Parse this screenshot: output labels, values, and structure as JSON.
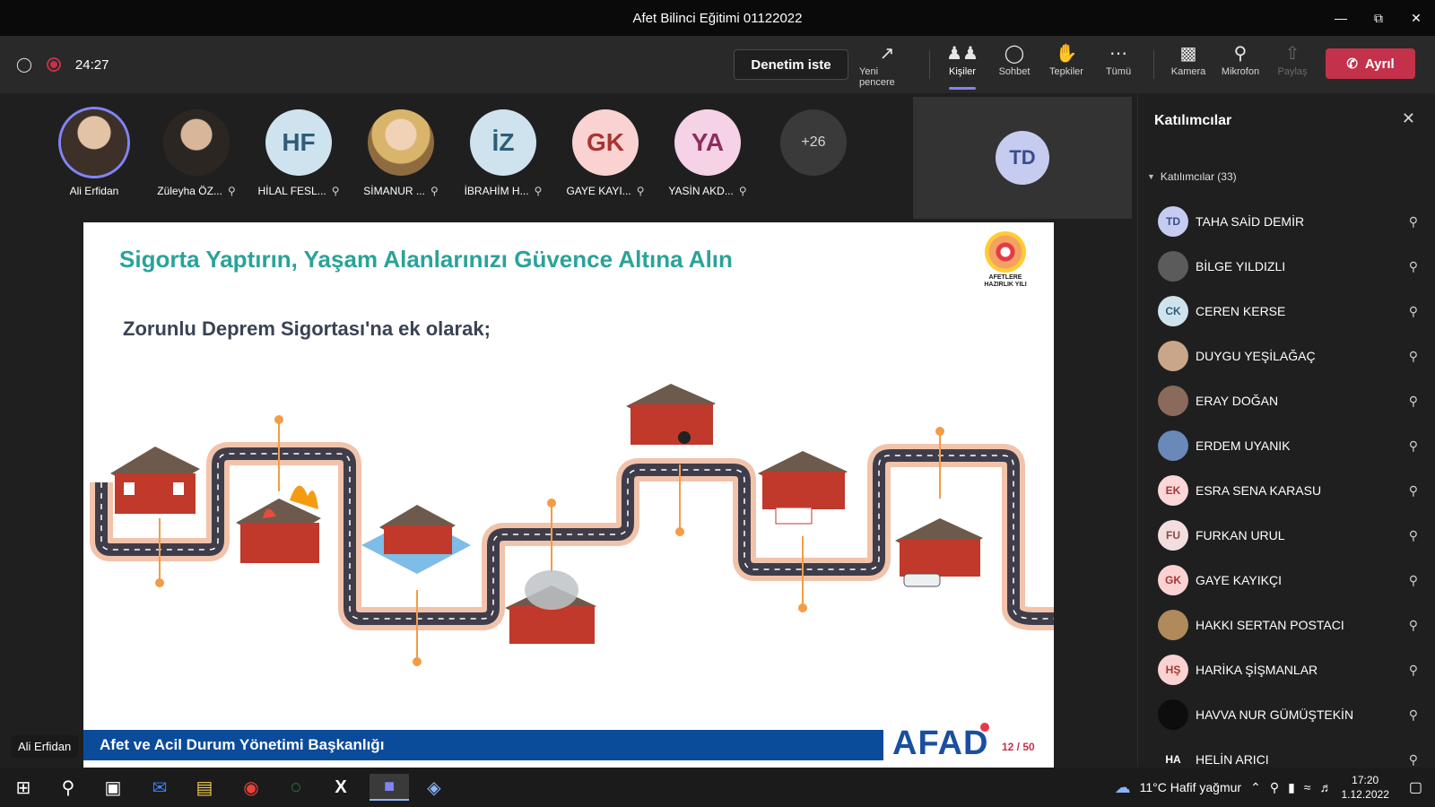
{
  "window": {
    "title": "Afet Bilinci Eğitimi 01122022"
  },
  "toolbar": {
    "timer": "24:27",
    "denetim_label": "Denetim iste",
    "buttons": {
      "new_window": "Yeni pencere",
      "people": "Kişiler",
      "chat": "Sohbet",
      "reactions": "Tepkiler",
      "more": "Tümü",
      "camera": "Kamera",
      "mic": "Mikrofon",
      "share": "Paylaş"
    },
    "leave_label": "Ayrıl"
  },
  "strip": {
    "participants": [
      {
        "name": "Ali Erfidan",
        "initials": ""
      },
      {
        "name": "Züleyha ÖZ...",
        "initials": ""
      },
      {
        "name": "HİLAL FESL...",
        "initials": "HF"
      },
      {
        "name": "SİMANUR ...",
        "initials": ""
      },
      {
        "name": "İBRAHİM H...",
        "initials": "İZ"
      },
      {
        "name": "GAYE KAYI...",
        "initials": "GK"
      },
      {
        "name": "YASİN AKD...",
        "initials": "YA"
      }
    ],
    "more_count": "+26",
    "tile_initials": "TD"
  },
  "slide": {
    "title": "Sigorta Yaptırın, Yaşam Alanlarınızı Güvence Altına Alın",
    "subtitle": "Zorunlu Deprem Sigortası'na ek olarak;",
    "logo_text": "AFETLERE HAZIRLIK YILI",
    "footer": "Afet ve Acil Durum Yönetimi Başkanlığı",
    "brand": "AFAD",
    "page": "12 / 50"
  },
  "presenter": "Ali Erfidan",
  "panel": {
    "title": "Katılımcılar",
    "section": "Katılımcılar (33)",
    "attendees": [
      {
        "name": "TAHA SAİD DEMİR",
        "initials": "TD",
        "color": "#c5ccf0",
        "fg": "#3a4c8a"
      },
      {
        "name": "BİLGE YILDIZLI",
        "initials": "",
        "color": "#5b5b5b",
        "fg": "#fff"
      },
      {
        "name": "CEREN KERSE",
        "initials": "CK",
        "color": "#cfe3ef",
        "fg": "#2f5d78"
      },
      {
        "name": "DUYGU YEŞİLAĞAÇ",
        "initials": "",
        "color": "#c9a58a",
        "fg": "#fff"
      },
      {
        "name": "ERAY DOĞAN",
        "initials": "",
        "color": "#8a6a5a",
        "fg": "#fff"
      },
      {
        "name": "ERDEM UYANIK",
        "initials": "",
        "color": "#6a88b8",
        "fg": "#fff"
      },
      {
        "name": "ESRA SENA KARASU",
        "initials": "EK",
        "color": "#fbd7d7",
        "fg": "#a33"
      },
      {
        "name": "FURKAN URUL",
        "initials": "FU",
        "color": "#f3dede",
        "fg": "#8a4a4a"
      },
      {
        "name": "GAYE KAYIKÇI",
        "initials": "GK",
        "color": "#fbd2d2",
        "fg": "#a33"
      },
      {
        "name": "HAKKI SERTAN POSTACI",
        "initials": "",
        "color": "#b08a5a",
        "fg": "#fff"
      },
      {
        "name": "HARİKA ŞİŞMANLAR",
        "initials": "HŞ",
        "color": "#fbd2d2",
        "fg": "#a33"
      },
      {
        "name": "HAVVA NUR GÜMÜŞTEKİN",
        "initials": "",
        "color": "#0d0d0d",
        "fg": "#fff"
      },
      {
        "name": "HELİN ARICI",
        "initials": "HA",
        "color": "#1f1f1f",
        "fg": "#fff"
      }
    ]
  },
  "taskbar": {
    "weather": "11°C  Hafif yağmur",
    "time": "17:20",
    "date": "1.12.2022"
  }
}
